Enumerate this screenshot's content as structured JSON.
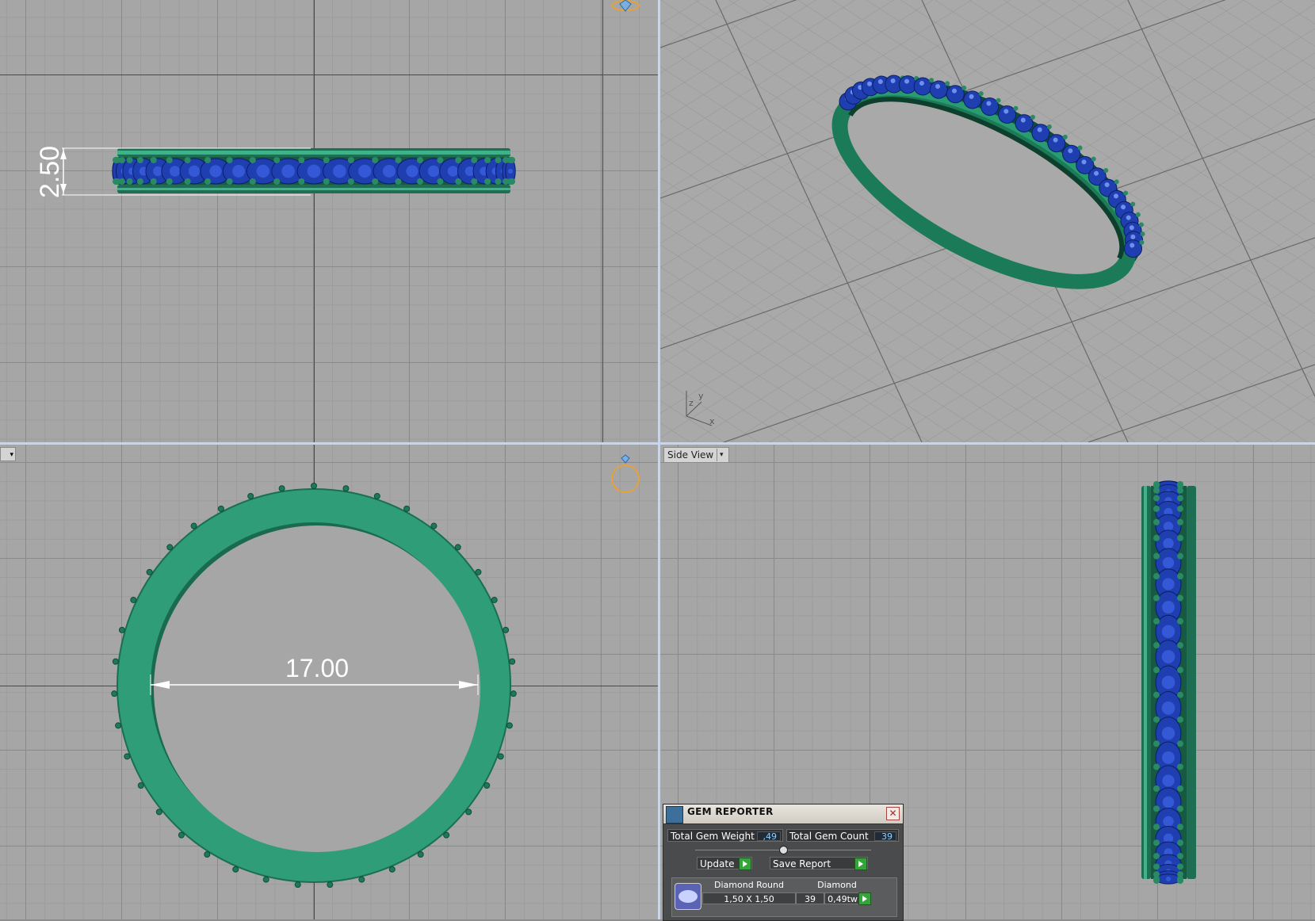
{
  "viewports": {
    "top_left": {
      "dimension": "2.50"
    },
    "bottom_left": {
      "dimension": "17.00"
    },
    "bottom_right": {
      "view_label": "Side View",
      "dropdown_glyph": "▾"
    },
    "bottom_left_menu": {
      "dropdown_glyph": "▾"
    },
    "perspective_axes": {
      "x": "x",
      "y": "y",
      "z": "z"
    }
  },
  "gem_reporter": {
    "title": "GEM REPORTER",
    "close_glyph": "✕",
    "total_gem_weight_label": "Total Gem Weight",
    "total_gem_weight_value": ",49",
    "total_gem_count_label": "Total Gem Count",
    "total_gem_count_value": "39",
    "update_label": "Update",
    "save_report_label": "Save Report",
    "table": {
      "col1_header": "Diamond Round",
      "col2_header": "Diamond",
      "size": "1,50 X 1,50",
      "count": "39",
      "weight": "0,49tw"
    }
  },
  "colors": {
    "metal": "#2f9e78",
    "gem": "#1f3fb0",
    "grid_bg": "#a6a6a6",
    "dimension": "#ffffff"
  }
}
